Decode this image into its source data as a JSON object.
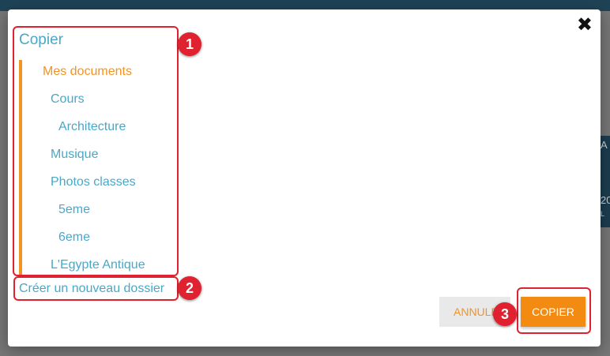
{
  "dialog": {
    "title": "Copier",
    "close_icon": "close-icon",
    "tree": [
      {
        "label": "Mes documents",
        "active": true
      },
      {
        "label": "Cours"
      },
      {
        "label": "Architecture"
      },
      {
        "label": "Musique"
      },
      {
        "label": "Photos classes"
      },
      {
        "label": "5eme"
      },
      {
        "label": "6eme"
      },
      {
        "label": "L'Egypte Antique"
      }
    ],
    "new_folder_label": "Créer un nouveau dossier",
    "cancel_label": "ANNULER",
    "copy_label": "COPIER"
  },
  "annotations": {
    "badge_1": "1",
    "badge_2": "2",
    "badge_3": "3"
  },
  "colors": {
    "accent_orange": "#f39323",
    "link_blue": "#4aa8c6",
    "annotation_red": "#e02130"
  },
  "background": {
    "thumb_text_1": "A",
    "thumb_text_2": "20",
    "thumb_text_3": "L"
  }
}
